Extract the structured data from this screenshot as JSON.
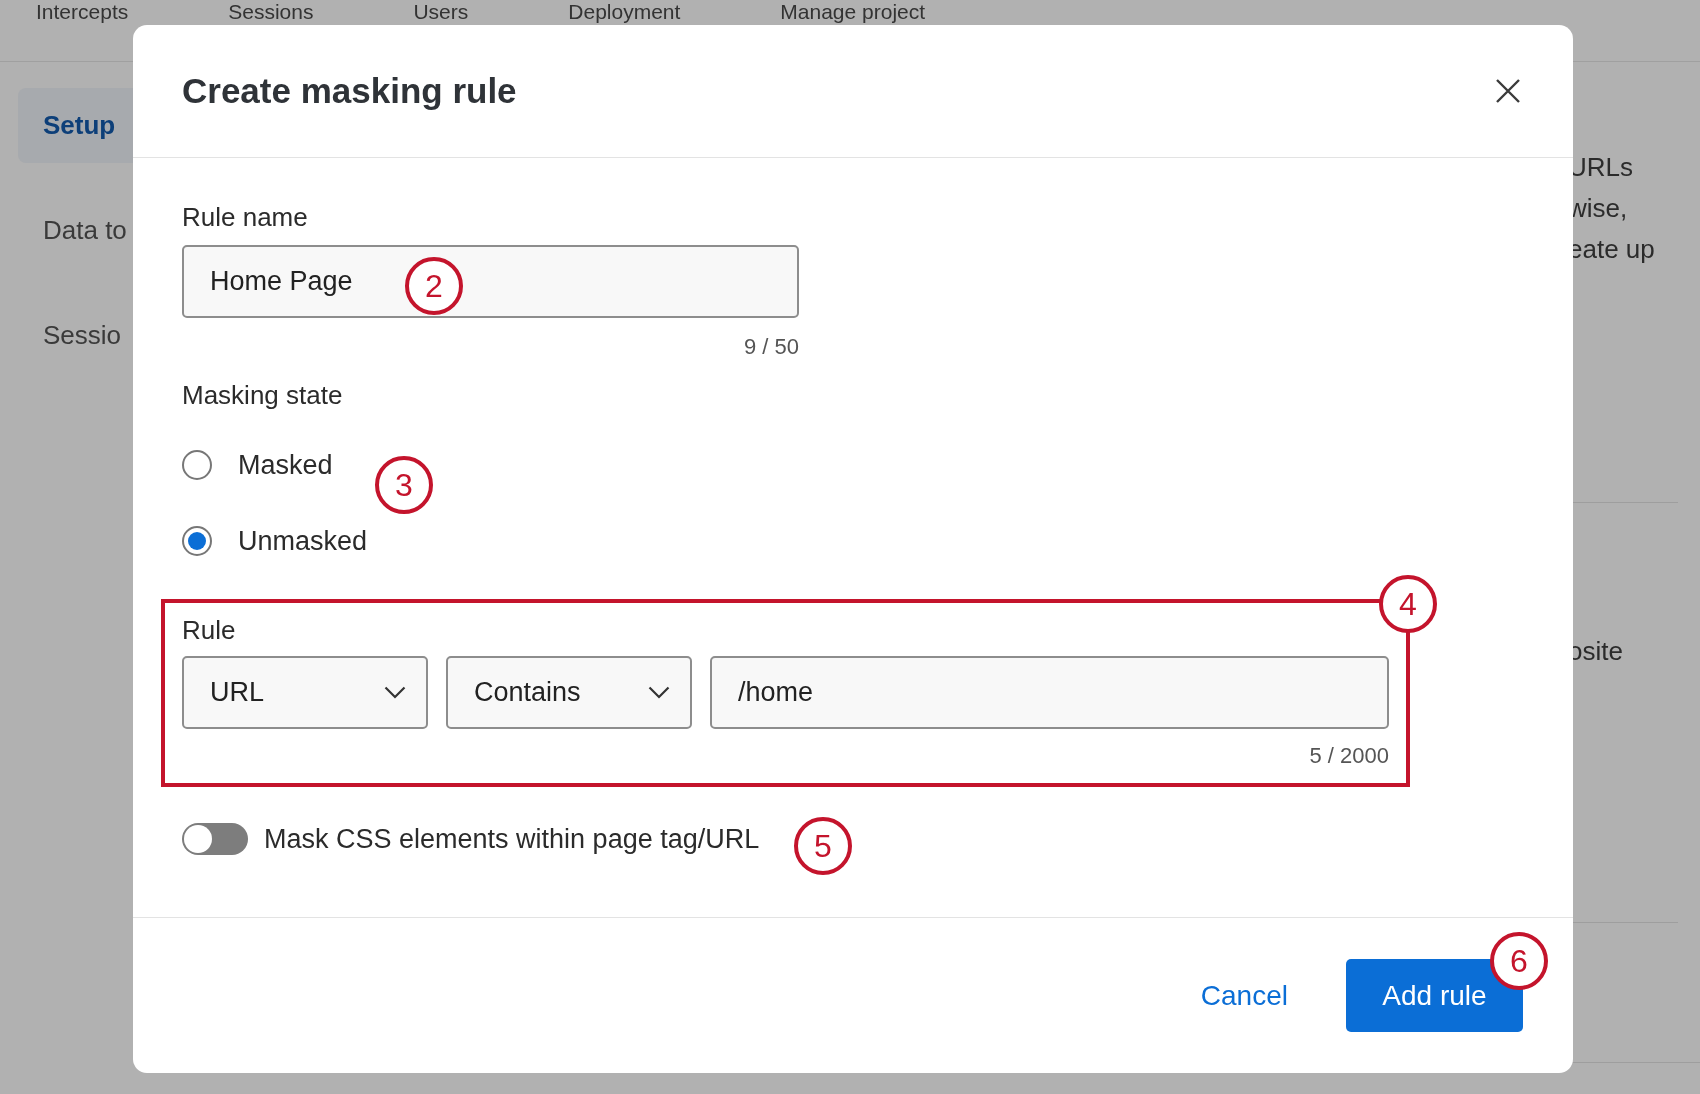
{
  "nav": {
    "tabs": [
      "Intercepts",
      "Sessions",
      "Users",
      "Deployment",
      "Manage project"
    ]
  },
  "sidebar": {
    "items": [
      {
        "label": "Setup",
        "selected": true
      },
      {
        "label": "Data to",
        "selected": false
      },
      {
        "label": "Sessio",
        "selected": false
      }
    ]
  },
  "background_text": [
    "URLs",
    "wise,",
    "eate up",
    "osite"
  ],
  "dialog": {
    "title": "Create masking rule",
    "rule_name": {
      "label": "Rule name",
      "value": "Home Page",
      "counter": "9 / 50"
    },
    "masking_state": {
      "label": "Masking state",
      "options": [
        {
          "label": "Masked",
          "selected": false
        },
        {
          "label": "Unmasked",
          "selected": true
        }
      ]
    },
    "rule": {
      "label": "Rule",
      "field": "URL",
      "operator": "Contains",
      "value": "/home",
      "counter": "5 / 2000"
    },
    "toggle": {
      "label": "Mask CSS elements within page tag/URL",
      "on": false
    },
    "buttons": {
      "cancel": "Cancel",
      "submit": "Add rule"
    }
  },
  "callouts": [
    "2",
    "3",
    "4",
    "5",
    "6"
  ]
}
